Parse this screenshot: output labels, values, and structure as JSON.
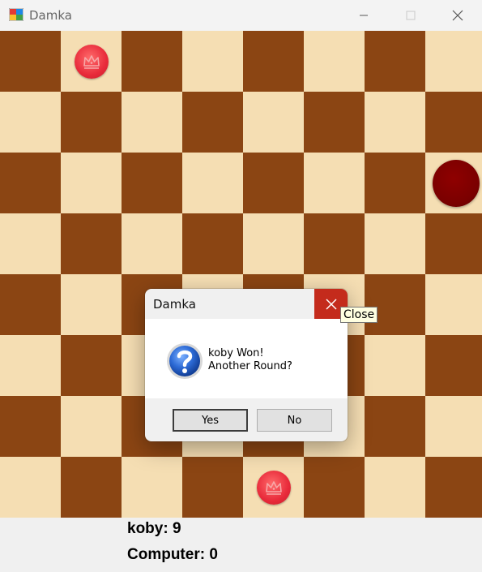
{
  "window": {
    "title": "Damka",
    "icons": {
      "minimize": "minimize-icon",
      "maximize": "maximize-icon",
      "close": "close-icon"
    }
  },
  "board": {
    "size": 8,
    "colors": {
      "light": "#f5deb3",
      "dark": "#8b4513"
    },
    "pieces": [
      {
        "row": 0,
        "col": 1,
        "type": "king",
        "color": "red"
      },
      {
        "row": 2,
        "col": 7,
        "type": "man",
        "color": "dark-red"
      },
      {
        "row": 7,
        "col": 4,
        "type": "king",
        "color": "red"
      }
    ]
  },
  "scores": {
    "player1": "koby: 9",
    "player2": "Computer: 0"
  },
  "dialog": {
    "title": "Damka",
    "message_line1": "koby Won!",
    "message_line2": "Another Round?",
    "yes_label": "Yes",
    "no_label": "No",
    "icon": "question-icon"
  },
  "tooltip": {
    "text": "Close"
  }
}
